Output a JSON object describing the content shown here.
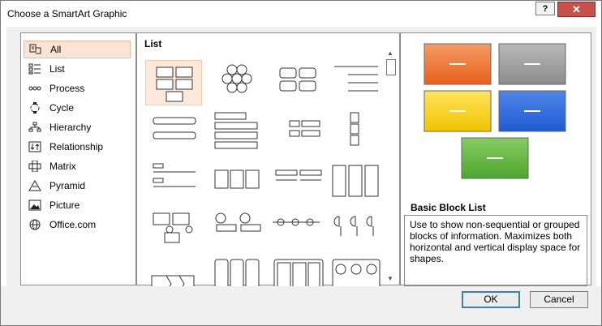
{
  "window": {
    "title": "Choose a SmartArt Graphic",
    "help_label": "?",
    "close_label": "✕"
  },
  "categories": [
    {
      "label": "All",
      "icon": "all-icon",
      "selected": true
    },
    {
      "label": "List",
      "icon": "list-icon"
    },
    {
      "label": "Process",
      "icon": "process-icon"
    },
    {
      "label": "Cycle",
      "icon": "cycle-icon"
    },
    {
      "label": "Hierarchy",
      "icon": "hierarchy-icon"
    },
    {
      "label": "Relationship",
      "icon": "relationship-icon"
    },
    {
      "label": "Matrix",
      "icon": "matrix-icon"
    },
    {
      "label": "Pyramid",
      "icon": "pyramid-icon"
    },
    {
      "label": "Picture",
      "icon": "picture-icon"
    },
    {
      "label": "Office.com",
      "icon": "globe-icon"
    }
  ],
  "gallery": {
    "heading": "List"
  },
  "preview": {
    "title": "Basic Block List",
    "description": "Use to show non-sequential or grouped blocks of information. Maximizes both horizontal and vertical display space for shapes.",
    "colors": {
      "orange": "#e8601c",
      "gray": "#8c8c8c",
      "yellow": "#f0c400",
      "blue": "#1f5bd0",
      "green": "#4fa52e"
    }
  },
  "footer": {
    "ok_label": "OK",
    "cancel_label": "Cancel"
  }
}
